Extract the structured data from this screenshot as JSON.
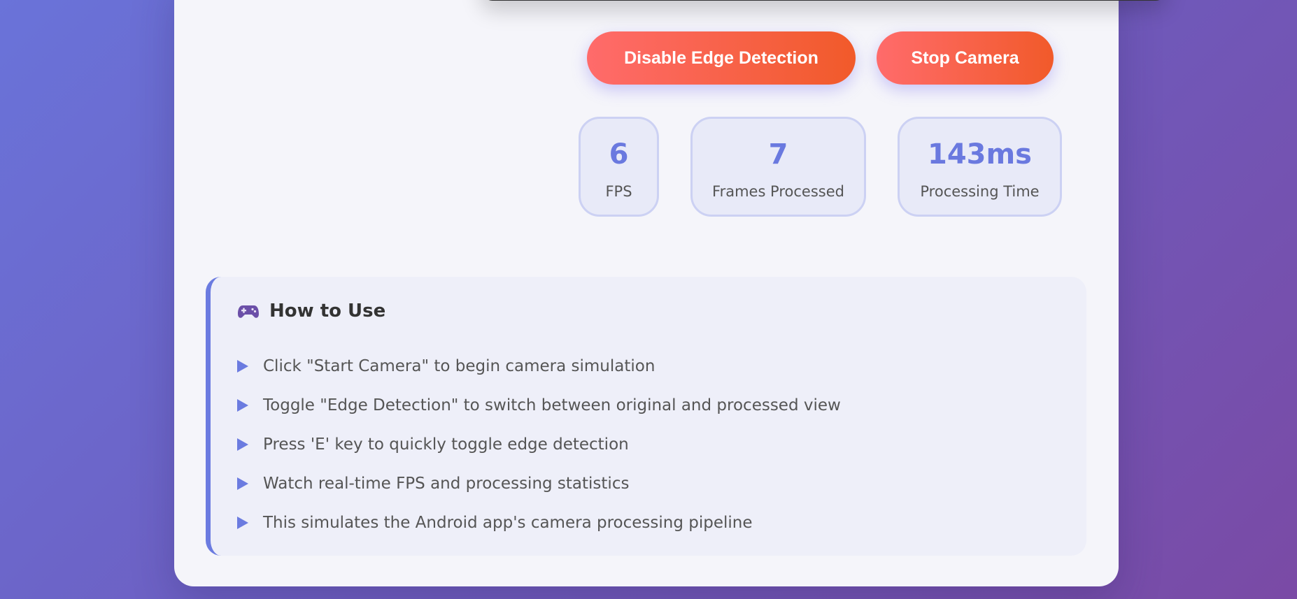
{
  "controls": {
    "edge_button": "Disable Edge Detection",
    "camera_button": "Stop Camera"
  },
  "stats": {
    "fps": {
      "value": "6",
      "label": "FPS"
    },
    "frames": {
      "value": "7",
      "label": "Frames Processed"
    },
    "time": {
      "value": "143ms",
      "label": "Processing Time"
    }
  },
  "howto": {
    "icon": "gamepad-icon",
    "title": "How to Use",
    "steps": [
      "Click \"Start Camera\" to begin camera simulation",
      "Toggle \"Edge Detection\" to switch between original and processed view",
      "Press 'E' key to quickly toggle edge detection",
      "Watch real-time FPS and processing statistics",
      "This simulates the Android app's camera processing pipeline"
    ]
  },
  "colors": {
    "accent": "#6b7be0",
    "button_gradient_start": "#ff6b6b",
    "button_gradient_end": "#f15a2a"
  }
}
